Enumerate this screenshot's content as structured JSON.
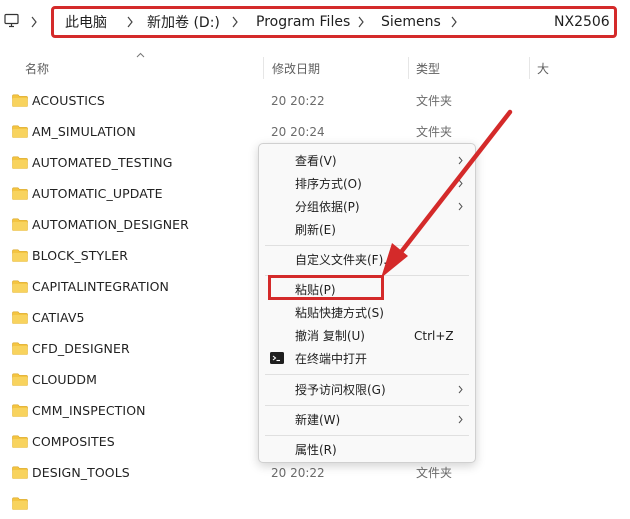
{
  "address_bar": {
    "crumbs": [
      "此电脑",
      "新加卷 (D:)",
      "Program Files",
      "Siemens",
      "NX2506"
    ]
  },
  "columns": {
    "name": "名称",
    "modified": "修改日期",
    "type": "类型",
    "size": "大"
  },
  "files": [
    {
      "name": "ACOUSTICS",
      "date": "20 20:22",
      "type": "文件夹"
    },
    {
      "name": "AM_SIMULATION",
      "date": "20 20:24",
      "type": "文件夹"
    },
    {
      "name": "AUTOMATED_TESTING",
      "date": "",
      "type": ""
    },
    {
      "name": "AUTOMATIC_UPDATE",
      "date": "",
      "type": ""
    },
    {
      "name": "AUTOMATION_DESIGNER",
      "date": "",
      "type": ""
    },
    {
      "name": "BLOCK_STYLER",
      "date": "",
      "type": ""
    },
    {
      "name": "CAPITALINTEGRATION",
      "date": "",
      "type": ""
    },
    {
      "name": "CATIAV5",
      "date": "",
      "type": ""
    },
    {
      "name": "CFD_DESIGNER",
      "date": "",
      "type": ""
    },
    {
      "name": "CLOUDDM",
      "date": "",
      "type": ""
    },
    {
      "name": "CMM_INSPECTION",
      "date": "",
      "type": ""
    },
    {
      "name": "COMPOSITES",
      "date": "",
      "type": ""
    },
    {
      "name": "DESIGN_TOOLS",
      "date": "20 20:22",
      "type": "文件夹"
    }
  ],
  "context_menu": {
    "items": [
      {
        "label": "查看(V)",
        "submenu": true
      },
      {
        "label": "排序方式(O)",
        "submenu": true
      },
      {
        "label": "分组依据(P)",
        "submenu": true
      },
      {
        "label": "刷新(E)",
        "submenu": false
      },
      {
        "label": "自定义文件夹(F)...",
        "submenu": false
      },
      {
        "label": "粘贴(P)",
        "submenu": false
      },
      {
        "label": "粘贴快捷方式(S)",
        "submenu": false
      },
      {
        "label": "撤消 复制(U)",
        "shortcut": "Ctrl+Z",
        "submenu": false
      },
      {
        "label": "在终端中打开",
        "icon": "terminal-icon",
        "submenu": false
      },
      {
        "label": "授予访问权限(G)",
        "submenu": true
      },
      {
        "label": "新建(W)",
        "submenu": true
      },
      {
        "label": "属性(R)",
        "submenu": false
      }
    ]
  },
  "colors": {
    "highlight": "#d42a2a",
    "folder": "#f4c542"
  }
}
